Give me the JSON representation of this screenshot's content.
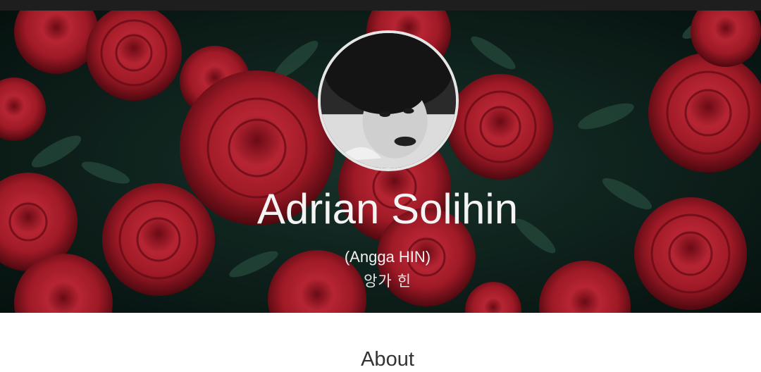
{
  "profile": {
    "name": "Adrian Solihin",
    "alias": "(Angga HIN)",
    "korean_name": "앙가 힌",
    "avatar_alt": "profile photo"
  },
  "sections": {
    "about_heading": "About"
  },
  "colors": {
    "topbar": "#1e1e1e",
    "hero_bg": "#0c1f1a",
    "rose": "#c21f2e",
    "text_light": "#f4f4f4",
    "heading_dark": "#333333"
  }
}
